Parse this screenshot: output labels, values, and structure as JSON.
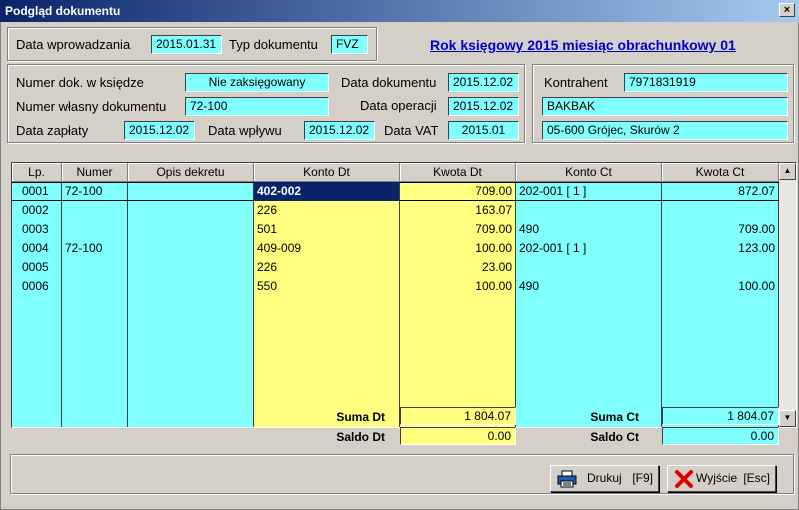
{
  "window": {
    "title": "Podgląd dokumentu",
    "close_glyph": "×"
  },
  "top": {
    "data_wprowadzania_label": "Data wprowadzania",
    "data_wprowadzania": "2015.01.31",
    "typ_label": "Typ dokumentu",
    "typ": "FVZ",
    "period_link": "Rok księgowy 2015 miesiąc obrachunkowy 01"
  },
  "doc": {
    "numer_ksiedze_label": "Numer dok. w księdze",
    "numer_ksiedze": "Nie zaksięgowany",
    "numer_wlasny_label": "Numer własny dokumentu",
    "numer_wlasny": "72-100",
    "data_zaplaty_label": "Data zapłaty",
    "data_zaplaty": "2015.12.02",
    "data_wplywu_label": "Data wpływu",
    "data_wplywu": "2015.12.02",
    "data_dokumentu_label": "Data dokumentu",
    "data_dokumentu": "2015.12.02",
    "data_operacji_label": "Data operacji",
    "data_operacji": "2015.12.02",
    "data_vat_label": "Data VAT",
    "data_vat": "2015.01"
  },
  "kontrahent": {
    "label": "Kontrahent",
    "nip": "7971831919",
    "name": "BAKBAK",
    "address": "05-600 Grójec, Skurów 2"
  },
  "table": {
    "headers": [
      "Lp.",
      "Numer",
      "Opis dekretu",
      "Konto Dt",
      "Kwota Dt",
      "Konto Ct",
      "Kwota Ct"
    ],
    "rows": [
      {
        "lp": "0001",
        "numer": "72-100",
        "opis": "",
        "konto_dt": "402-002",
        "kwota_dt": "709.00",
        "konto_ct": "202-001 [ 1 ]",
        "kwota_ct": "872.07"
      },
      {
        "lp": "0002",
        "numer": "",
        "opis": "",
        "konto_dt": "226",
        "kwota_dt": "163.07",
        "konto_ct": "",
        "kwota_ct": ""
      },
      {
        "lp": "0003",
        "numer": "",
        "opis": "",
        "konto_dt": "501",
        "kwota_dt": "709.00",
        "konto_ct": "490",
        "kwota_ct": "709.00"
      },
      {
        "lp": "0004",
        "numer": "72-100",
        "opis": "",
        "konto_dt": "409-009",
        "kwota_dt": "100.00",
        "konto_ct": "202-001 [ 1 ]",
        "kwota_ct": "123.00"
      },
      {
        "lp": "0005",
        "numer": "",
        "opis": "",
        "konto_dt": "226",
        "kwota_dt": "23.00",
        "konto_ct": "",
        "kwota_ct": ""
      },
      {
        "lp": "0006",
        "numer": "",
        "opis": "",
        "konto_dt": "550",
        "kwota_dt": "100.00",
        "konto_ct": "490",
        "kwota_ct": "100.00"
      }
    ],
    "scroll_up": "▲",
    "scroll_down": "▼"
  },
  "totals": {
    "suma_dt_label": "Suma Dt",
    "suma_dt": "1 804.07",
    "saldo_dt_label": "Saldo Dt",
    "saldo_dt": "0.00",
    "suma_ct_label": "Suma Ct",
    "suma_ct": "1 804.07",
    "saldo_ct_label": "Saldo Ct",
    "saldo_ct": "0.00"
  },
  "buttons": {
    "print_label": "Drukuj",
    "print_key": "[F9]",
    "exit_label": "Wyjście",
    "exit_key": "[Esc]"
  },
  "colors": {
    "field": "#80ffff",
    "debit": "#ffff80",
    "selection": "#0a246a",
    "link": "#0000cc",
    "exit_icon": "#e00000"
  }
}
